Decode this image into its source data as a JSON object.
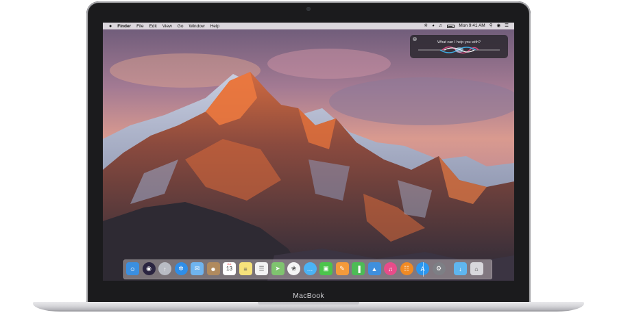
{
  "device": {
    "brand_label": "MacBook"
  },
  "menubar": {
    "app_name": "Finder",
    "items": [
      "File",
      "Edit",
      "View",
      "Go",
      "Window",
      "Help"
    ],
    "clock": "Mon 9:41 AM",
    "status_icons": [
      "bluetooth-icon",
      "wifi-icon",
      "volume-icon",
      "battery-icon",
      "search-icon",
      "siri-icon",
      "notification-center-icon"
    ],
    "battery_level": 0.85
  },
  "siri": {
    "prompt": "What can I help you with?"
  },
  "dock": {
    "apps": [
      {
        "name": "finder-icon",
        "color": "#3b8fe0"
      },
      {
        "name": "siri-app-icon",
        "color": "#2a2440"
      },
      {
        "name": "launchpad-icon",
        "color": "#b9bcc4"
      },
      {
        "name": "safari-icon",
        "color": "#2f8ee8"
      },
      {
        "name": "mail-icon",
        "color": "#6fb4ef"
      },
      {
        "name": "contacts-icon",
        "color": "#b08a5e"
      },
      {
        "name": "calendar-icon",
        "color": "#ffffff",
        "month": "JUL",
        "day": "13"
      },
      {
        "name": "notes-icon",
        "color": "#f6e27b"
      },
      {
        "name": "reminders-icon",
        "color": "#f3f3f3"
      },
      {
        "name": "maps-icon",
        "color": "#7fc46f"
      },
      {
        "name": "photos-icon",
        "color": "#f5f5f5"
      },
      {
        "name": "messages-icon",
        "color": "#4bb3f5"
      },
      {
        "name": "facetime-icon",
        "color": "#4cc44c"
      },
      {
        "name": "pages-icon",
        "color": "#f49a3b"
      },
      {
        "name": "numbers-icon",
        "color": "#4dbb55"
      },
      {
        "name": "keynote-icon",
        "color": "#3f8fdd"
      },
      {
        "name": "itunes-icon",
        "color": "#e84c8a"
      },
      {
        "name": "ibooks-icon",
        "color": "#f08a24"
      },
      {
        "name": "app-store-icon",
        "color": "#2b97ee"
      },
      {
        "name": "system-preferences-icon",
        "color": "#7d7f85"
      },
      {
        "name": "downloads-folder-icon",
        "color": "#5fb6ef"
      },
      {
        "name": "trash-icon",
        "color": "#d8d8dc"
      }
    ]
  }
}
